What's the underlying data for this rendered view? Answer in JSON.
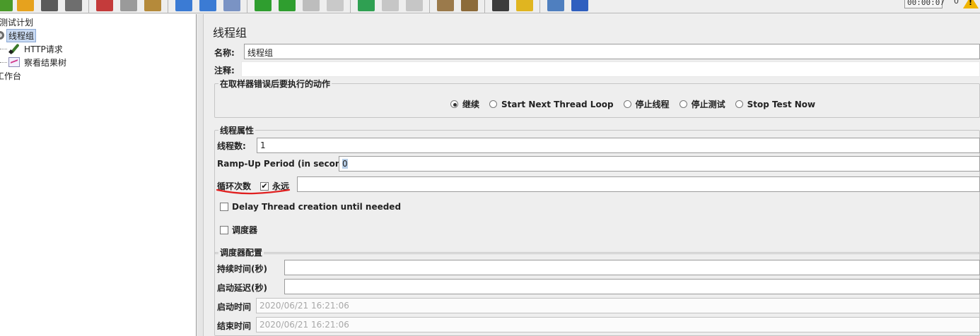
{
  "toolbar": {
    "timer": "00:00:07",
    "active_count": "0",
    "warning_symbol": "!",
    "buttons": [
      {
        "name": "new-icon",
        "color": "#4a9a2a"
      },
      {
        "name": "templates-icon",
        "color": "#e6a21e"
      },
      {
        "name": "save-icon",
        "color": "#5a5a5a"
      },
      {
        "name": "save-as-icon",
        "color": "#6e6e6e"
      },
      {
        "name": "cut-icon",
        "color": "#c43b3b"
      },
      {
        "name": "copy-icon",
        "color": "#9a9a9a"
      },
      {
        "name": "paste-icon",
        "color": "#b58a3a"
      },
      {
        "name": "expand-icon",
        "color": "#3b7bd4"
      },
      {
        "name": "collapse-icon",
        "color": "#3b7bd4"
      },
      {
        "name": "toggle-icon",
        "color": "#7a93c4"
      },
      {
        "name": "start-icon",
        "color": "#2f9e2f"
      },
      {
        "name": "start-no-pauses-icon",
        "color": "#2f9e2f"
      },
      {
        "name": "stop-icon",
        "color": "#bdbdbd"
      },
      {
        "name": "shutdown-icon",
        "color": "#c9c9c9"
      },
      {
        "name": "remote-start-icon",
        "color": "#2fa052"
      },
      {
        "name": "remote-stop-icon",
        "color": "#c6c6c6"
      },
      {
        "name": "remote-shutdown-icon",
        "color": "#c6c6c6"
      },
      {
        "name": "clear-icon",
        "color": "#9b7a4b"
      },
      {
        "name": "clear-all-icon",
        "color": "#8c6b3a"
      },
      {
        "name": "search-icon",
        "color": "#3c3c3c"
      },
      {
        "name": "reset-search-icon",
        "color": "#e0b520"
      },
      {
        "name": "function-helper-icon",
        "color": "#4f7fbf"
      },
      {
        "name": "help-icon",
        "color": "#2f5fbf"
      }
    ]
  },
  "tree": {
    "items": [
      {
        "label": "测试计划"
      },
      {
        "label": "线程组"
      },
      {
        "label": "HTTP请求"
      },
      {
        "label": "察看结果树"
      },
      {
        "label": "工作台"
      }
    ]
  },
  "panel": {
    "title": "线程组",
    "name_label": "名称:",
    "name_value": "线程组",
    "comment_label": "注释:",
    "comment_value": ""
  },
  "error_action": {
    "title": "在取样器错误后要执行的动作",
    "options": [
      {
        "label": "继续",
        "selected": true
      },
      {
        "label": "Start Next Thread Loop",
        "selected": false
      },
      {
        "label": "停止线程",
        "selected": false
      },
      {
        "label": "停止测试",
        "selected": false
      },
      {
        "label": "Stop Test Now",
        "selected": false
      }
    ]
  },
  "thread_props": {
    "title": "线程属性",
    "threads_label": "线程数:",
    "threads_value": "1",
    "rampup_label": "Ramp-Up Period (in seconds):",
    "rampup_value": "0",
    "loop_label": "循环次数",
    "forever_label": "永远",
    "forever_checked": true,
    "forever_check_glyph": "✔",
    "loop_value": "",
    "delay_label": "Delay Thread creation until needed",
    "delay_checked": false,
    "scheduler_label": "调度器",
    "scheduler_checked": false
  },
  "scheduler_config": {
    "title": "调度器配置",
    "duration_label": "持续时间(秒)",
    "duration_value": "",
    "delay_label": "启动延迟(秒)",
    "delay_value": "",
    "start_label": "启动时间",
    "start_value": "2020/06/21 16:21:06",
    "end_label": "结束时间",
    "end_value": "2020/06/21 16:21:06"
  },
  "colors": {
    "annotation_underline": "#e02020",
    "selected_tree_bg": "#c9daf2"
  }
}
